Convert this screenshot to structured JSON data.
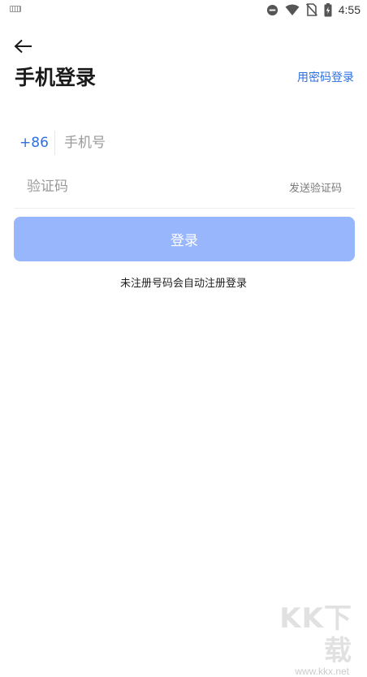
{
  "status_bar": {
    "time": "4:55",
    "icons": [
      "keyboard-icon",
      "do-not-disturb-icon",
      "wifi-icon",
      "no-sim-icon",
      "battery-charging-icon"
    ]
  },
  "header": {
    "back_icon": "arrow-left-icon",
    "title": "手机登录",
    "password_login_label": "用密码登录"
  },
  "form": {
    "country_code": "+86",
    "phone_placeholder": "手机号",
    "phone_value": "",
    "code_placeholder": "验证码",
    "code_value": "",
    "send_code_label": "发送验证码",
    "login_label": "登录",
    "hint": "未注册号码会自动注册登录"
  },
  "colors": {
    "accent": "#2f6fe0",
    "login_button_disabled": "#97b6fc"
  },
  "watermark": {
    "logo": "KK下载",
    "url": "www.kkx.net"
  }
}
